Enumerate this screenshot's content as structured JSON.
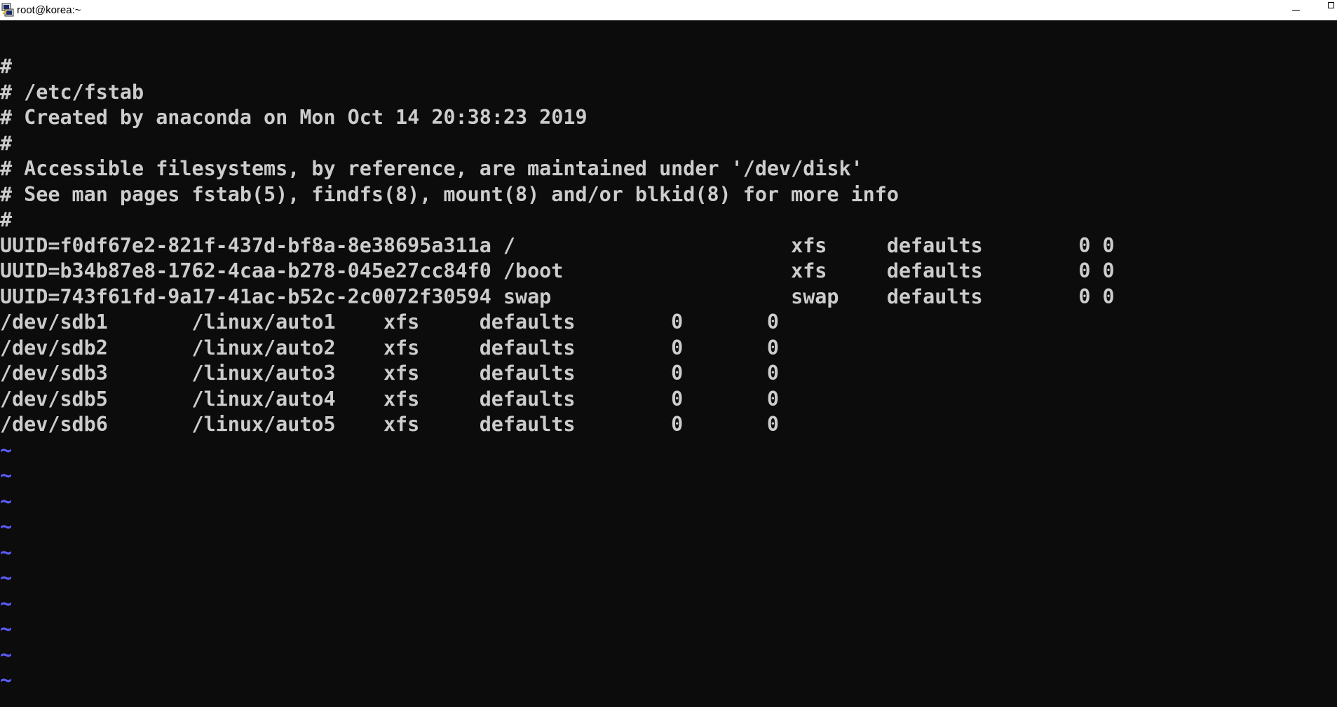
{
  "window": {
    "title": "root@korea:~"
  },
  "colors": {
    "background": "#0c0c0c",
    "text": "#cccccc",
    "tilde": "#5c5cff",
    "titlebar": "#ffffff"
  },
  "icons": {
    "app": "putty-terminal-icon",
    "minimize": "minimize-icon",
    "maximize": "maximize-icon"
  },
  "editor": {
    "lines": [
      "#",
      "# /etc/fstab",
      "# Created by anaconda on Mon Oct 14 20:38:23 2019",
      "#",
      "# Accessible filesystems, by reference, are maintained under '/dev/disk'",
      "# See man pages fstab(5), findfs(8), mount(8) and/or blkid(8) for more info",
      "#",
      "UUID=f0df67e2-821f-437d-bf8a-8e38695a311a /                       xfs     defaults        0 0",
      "UUID=b34b87e8-1762-4caa-b278-045e27cc84f0 /boot                   xfs     defaults        0 0",
      "UUID=743f61fd-9a17-41ac-b52c-2c0072f30594 swap                    swap    defaults        0 0",
      "/dev/sdb1       /linux/auto1    xfs     defaults        0       0",
      "/dev/sdb2       /linux/auto2    xfs     defaults        0       0",
      "/dev/sdb3       /linux/auto3    xfs     defaults        0       0",
      "/dev/sdb5       /linux/auto4    xfs     defaults        0       0",
      "/dev/sdb6       /linux/auto5    xfs     defaults        0       0"
    ],
    "empty_marker": "~",
    "empty_line_count": 10
  }
}
